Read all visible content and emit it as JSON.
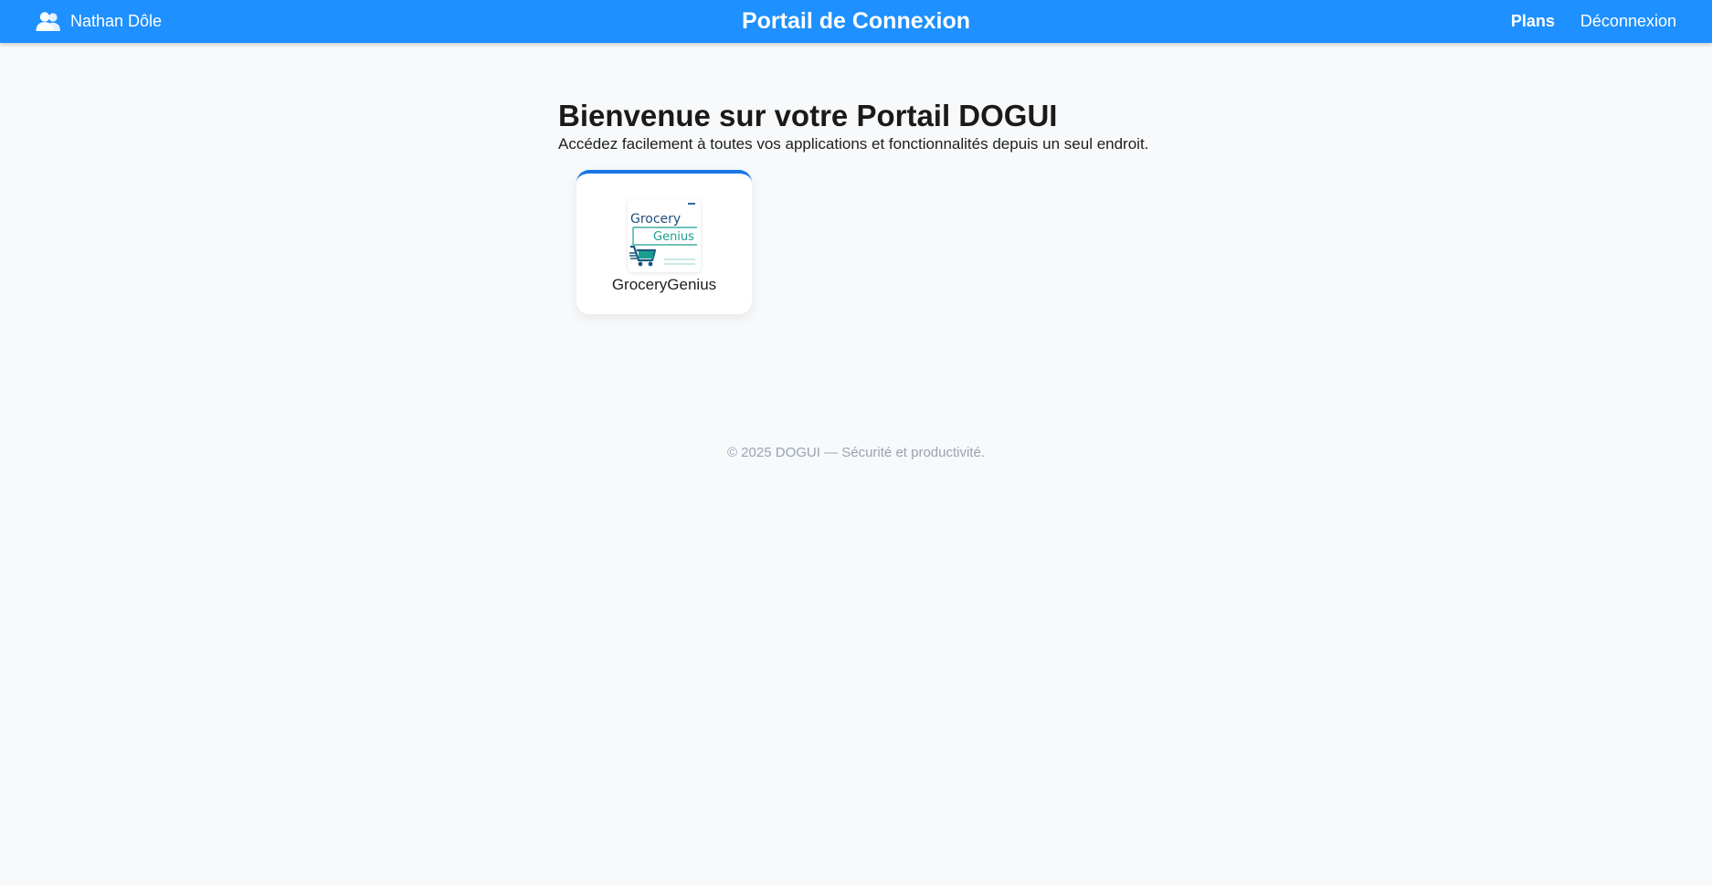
{
  "header": {
    "user_name": "Nathan Dôle",
    "user_icon": "users-icon",
    "title": "Portail de Connexion",
    "nav": {
      "plans": "Plans",
      "logout": "Déconnexion"
    }
  },
  "main": {
    "title": "Bienvenue sur votre Portail DOGUI",
    "subtitle": "Accédez facilement à toutes vos applications et fonctionnalités depuis un seul endroit.",
    "apps": [
      {
        "name": "GroceryGenius",
        "logo": {
          "line1": "Grocery",
          "line2": "Genius"
        }
      }
    ]
  },
  "footer": {
    "text": "© 2025 DOGUI — Sécurité et productivité."
  },
  "colors": {
    "header_bg": "#1e90ff",
    "card_accent": "#1877e6",
    "page_bg": "#f7f9fb",
    "logo_teal": "#1a9e8f",
    "logo_navy": "#1f4f7a"
  }
}
